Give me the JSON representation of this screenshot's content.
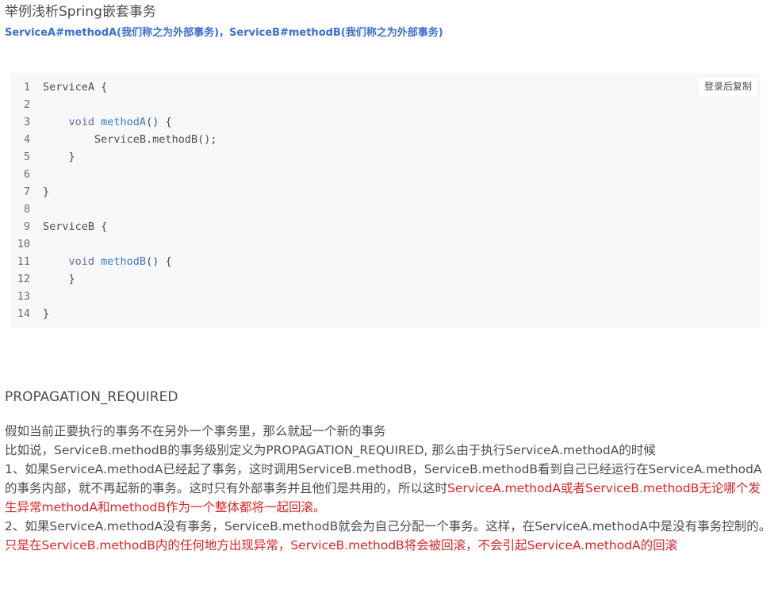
{
  "header": {
    "title": "举例浅析Spring嵌套事务",
    "subtitle": "ServiceA#methodA(我们称之为外部事务)，ServiceB#methodB(我们称之为外部事务)"
  },
  "code_block": {
    "copy_label": "登录后复制",
    "lines": [
      {
        "num": "1",
        "indent": "",
        "kw": "",
        "fn": "",
        "rest": "ServiceA {"
      },
      {
        "num": "2",
        "indent": "",
        "kw": "",
        "fn": "",
        "rest": ""
      },
      {
        "num": "3",
        "indent": "    ",
        "kw": "void ",
        "fn": "methodA",
        "rest": "() {"
      },
      {
        "num": "4",
        "indent": "        ",
        "kw": "",
        "fn": "",
        "rest": "ServiceB.methodB();"
      },
      {
        "num": "5",
        "indent": "    ",
        "kw": "",
        "fn": "",
        "rest": "}"
      },
      {
        "num": "6",
        "indent": "",
        "kw": "",
        "fn": "",
        "rest": ""
      },
      {
        "num": "7",
        "indent": "",
        "kw": "",
        "fn": "",
        "rest": "}"
      },
      {
        "num": "8",
        "indent": "",
        "kw": "",
        "fn": "",
        "rest": ""
      },
      {
        "num": "9",
        "indent": "",
        "kw": "",
        "fn": "",
        "rest": "ServiceB {"
      },
      {
        "num": "10",
        "indent": "",
        "kw": "",
        "fn": "",
        "rest": ""
      },
      {
        "num": "11",
        "indent": "    ",
        "kw": "void ",
        "fn": "methodB",
        "rest": "() {"
      },
      {
        "num": "12",
        "indent": "    ",
        "kw": "",
        "fn": "",
        "rest": "}"
      },
      {
        "num": "13",
        "indent": "",
        "kw": "",
        "fn": "",
        "rest": ""
      },
      {
        "num": "14",
        "indent": "",
        "kw": "",
        "fn": "",
        "rest": "}"
      }
    ]
  },
  "section": {
    "heading": "PROPAGATION_REQUIRED",
    "p1": "假如当前正要执行的事务不在另外一个事务里，那么就起一个新的事务",
    "p2": "比如说，ServiceB.methodB的事务级别定义为PROPAGATION_REQUIRED, 那么由于执行ServiceA.methodA的时候",
    "p3_normal": "  1、如果ServiceA.methodA已经起了事务，这时调用ServiceB.methodB，ServiceB.methodB看到自己已经运行在ServiceA.methodA的事务内部，就不再起新的事务。这时只有外部事务并且他们是共用的，所以这时",
    "p3_red": "ServiceA.methodA或者ServiceB.methodB无论哪个发生异常methodA和methodB作为一个整体都将一起回滚。",
    "p4_normal": "  2、如果ServiceA.methodA没有事务，ServiceB.methodB就会为自己分配一个事务。这样，在ServiceA.methodA中是没有事务控制的。",
    "p4_red": "只是在ServiceB.methodB内的任何地方出现异常，ServiceB.methodB将会被回滚，不会引起ServiceA.methodA的回滚"
  }
}
